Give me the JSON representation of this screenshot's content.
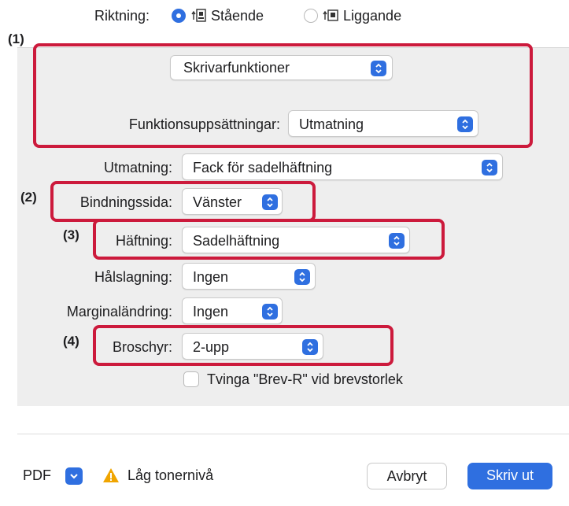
{
  "orientation": {
    "label": "Riktning:",
    "portrait": "Stående",
    "landscape": "Liggande"
  },
  "feature_menu": {
    "value": "Skrivarfunktioner"
  },
  "feature_sets": {
    "label": "Funktionsuppsättningar:",
    "value": "Utmatning"
  },
  "output": {
    "label": "Utmatning:",
    "value": "Fack för sadelhäftning"
  },
  "binding": {
    "label": "Bindningssida:",
    "value": "Vänster"
  },
  "stapling": {
    "label": "Häftning:",
    "value": "Sadelhäftning"
  },
  "punch": {
    "label": "Hålslagning:",
    "value": "Ingen"
  },
  "margin": {
    "label": "Marginaländring:",
    "value": "Ingen"
  },
  "booklet": {
    "label": "Broschyr:",
    "value": "2-upp"
  },
  "force_letter": {
    "label": "Tvinga \"Brev-R\" vid brevstorlek",
    "checked": false
  },
  "footer": {
    "pdf_label": "PDF",
    "warning": "Låg tonernivå",
    "cancel": "Avbryt",
    "print": "Skriv ut"
  },
  "annotations": [
    "(1)",
    "(2)",
    "(3)",
    "(4)"
  ],
  "colors": {
    "accent": "#2f6fe0",
    "highlight": "#cc1a3c",
    "warning": "#f0a500"
  }
}
